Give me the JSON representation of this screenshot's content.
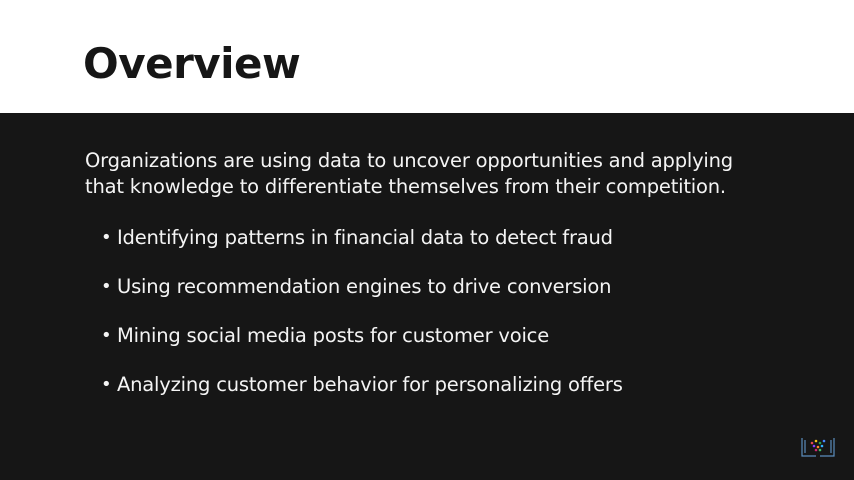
{
  "slide": {
    "title": "Overview",
    "intro_lines": [
      "Organizations are using data to uncover opportunities and applying",
      "that knowledge to differentiate themselves from their competition."
    ],
    "bullets": [
      "Identifying patterns in financial data to detect fraud",
      "Using recommendation engines to drive conversion",
      "Mining social media posts for customer voice",
      "Analyzing customer behavior for personalizing offers"
    ],
    "bullet_glyph": "•"
  },
  "colors": {
    "header_bg": "#ffffff",
    "body_bg": "#161616",
    "title_text": "#161616",
    "body_text": "#f4f4f4",
    "logo_accent": "#5b8dbd"
  },
  "icons": {
    "logo": "brand-logo-icon"
  }
}
